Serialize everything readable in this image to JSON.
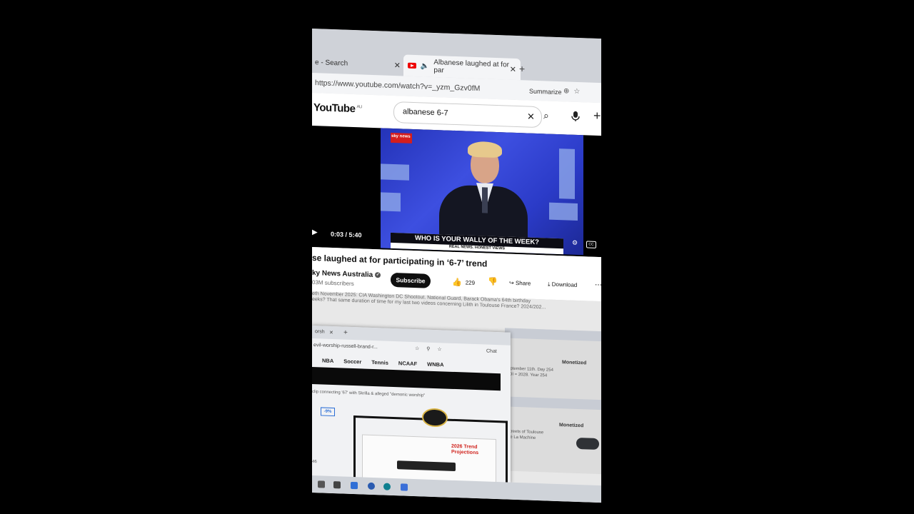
{
  "browser": {
    "tabs": [
      {
        "label": "e - Search"
      },
      {
        "label": "Albanese laughed at for par"
      }
    ],
    "url": "https://www.youtube.com/watch?v=_yzm_Gzv0fM",
    "summarize_label": "Summarize"
  },
  "youtube": {
    "logo": "YouTube",
    "region": "AU",
    "search_value": "albanese 6-7"
  },
  "player": {
    "channel_logo": "sky news",
    "lower_third_title": "WHO IS YOUR WALLY OF THE WEEK?",
    "lower_third_sub": "REAL NEWS. HONEST VIEWS",
    "time": "0:03 / 5:40",
    "cc_label": "CC"
  },
  "video": {
    "title": "se laughed at for participating in ‘6-7’ trend",
    "channel": "ky News Australia",
    "subscribers": "03M subscribers",
    "subscribe_label": "Subscribe",
    "likes": "229",
    "share_label": "Share",
    "download_label": "Download"
  },
  "description": {
    "line1": "eth November 2025: CIA Washington DC Shootout. National Guard, Barack Obama's 64th birthday",
    "line2": "eeks? That same duration of time for my last two videos concerning Lilith in Toulouse France? 2024/202..."
  },
  "background_panel": {
    "monetized_1": "Monetized",
    "monetized_2": "Monetized",
    "text_1": "eptember 11th. Day 254",
    "text_2": "IOI = 2028. Year 254",
    "text_3": "streets of Toulouse",
    "text_4": "de La Machine"
  },
  "overlay_window": {
    "tab": "orsh",
    "url": "evil-worship-russell-brand-r...",
    "chat_label": "Chat",
    "nav": [
      "NBA",
      "Soccer",
      "Tennis",
      "NCAAF",
      "WNBA"
    ],
    "caption": "clip connecting '67' with Skrilla & alleged \"demonic worship\"",
    "badge": "-9%",
    "trend_label": "2026 Trend Projections",
    "number": "46"
  }
}
